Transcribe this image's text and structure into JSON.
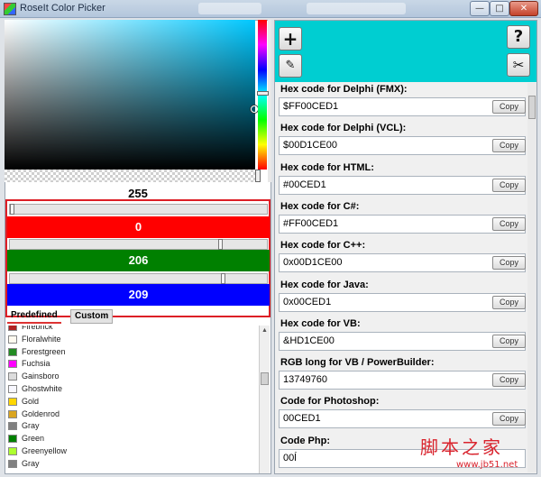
{
  "window": {
    "title": "RoseIt Color Picker",
    "min_label": "—",
    "max_label": "□",
    "close_label": "✕"
  },
  "picker": {
    "alpha_value": "255",
    "red_value": "0",
    "green_value": "206",
    "blue_value": "209",
    "selected_color": "#00CED1"
  },
  "tabs": [
    {
      "label": "Predefined"
    },
    {
      "label": "Custom"
    }
  ],
  "color_list": [
    {
      "name": "Firebrick",
      "color": "#b22222"
    },
    {
      "name": "Floralwhite",
      "color": "#fffaf0"
    },
    {
      "name": "Forestgreen",
      "color": "#228b22"
    },
    {
      "name": "Fuchsia",
      "color": "#ff00ff"
    },
    {
      "name": "Gainsboro",
      "color": "#dcdcdc"
    },
    {
      "name": "Ghostwhite",
      "color": "#f8f8ff"
    },
    {
      "name": "Gold",
      "color": "#ffd700"
    },
    {
      "name": "Goldenrod",
      "color": "#daa520"
    },
    {
      "name": "Gray",
      "color": "#808080"
    },
    {
      "name": "Green",
      "color": "#008000"
    },
    {
      "name": "Greenyellow",
      "color": "#adff2f"
    },
    {
      "name": "Gray",
      "color": "#808080"
    }
  ],
  "toolbar": {
    "add_label": "+",
    "eyedropper_label": "✎",
    "help_label": "?",
    "tools_label": "✂"
  },
  "codes": [
    {
      "label": "Hex code for Delphi (FMX):",
      "value": "$FF00CED1",
      "copy": "Copy"
    },
    {
      "label": "Hex code for Delphi (VCL):",
      "value": "$00D1CE00",
      "copy": "Copy"
    },
    {
      "label": "Hex code for HTML:",
      "value": "#00CED1",
      "copy": "Copy"
    },
    {
      "label": "Hex code for C#:",
      "value": "#FF00CED1",
      "copy": "Copy"
    },
    {
      "label": "Hex code for C++:",
      "value": "0x00D1CE00",
      "copy": "Copy"
    },
    {
      "label": "Hex code for Java:",
      "value": "0x00CED1",
      "copy": "Copy"
    },
    {
      "label": "Hex code for VB:",
      "value": "&HD1CE00",
      "copy": "Copy"
    },
    {
      "label": "RGB long for VB / PowerBuilder:",
      "value": "13749760",
      "copy": "Copy"
    },
    {
      "label": "Code for Photoshop:",
      "value": "00CED1",
      "copy": "Copy"
    },
    {
      "label": "Code Php:",
      "value": "00ĺ",
      "copy": ""
    }
  ],
  "watermark": {
    "text": "脚本之家",
    "url": "www.jb51.net"
  },
  "colors": {
    "accent": "#00CED1",
    "red_channel": "#ff0000",
    "green_channel": "#008000",
    "blue_channel": "#0000ff",
    "highlight_frame": "#dd1f26"
  }
}
